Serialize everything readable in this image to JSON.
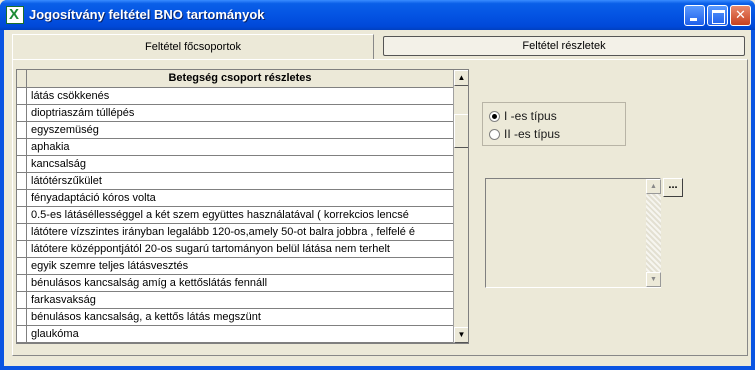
{
  "window": {
    "title": "Jogosítvány feltétel BNO tartományok",
    "app_icon": "X"
  },
  "tabs": [
    {
      "label": "Feltétel főcsoportok",
      "selected": false
    },
    {
      "label": "Feltétel részletek",
      "selected": true
    }
  ],
  "grid": {
    "column_header": "Betegség csoport részletes",
    "rows": [
      "látás csökkenés",
      "dioptriaszám túllépés",
      "egyszemüség",
      "aphakia",
      "kancsalság",
      "látótérszűkület",
      "fényadaptáció kóros volta",
      "0.5-es látáséllességgel a két szem együttes használatával ( korrekcios lencsé",
      "látótere vízszintes irányban legalább 120-os,amely 50-ot balra jobbra , felfelé é",
      "látótere középpontjától 20-os sugarú tartományon belül látása nem terhelt",
      "egyik szemre teljes látásvesztés",
      "bénulásos kancsalság amíg a kettőslátás fennáll",
      "farkasvakság",
      "bénulásos kancsalság, a kettős látás megszünt",
      "glaukóma"
    ]
  },
  "type_options": [
    {
      "label": "I -es típus",
      "checked": true
    },
    {
      "label": "II -es típus",
      "checked": false
    }
  ],
  "ellipsis_button": "..."
}
